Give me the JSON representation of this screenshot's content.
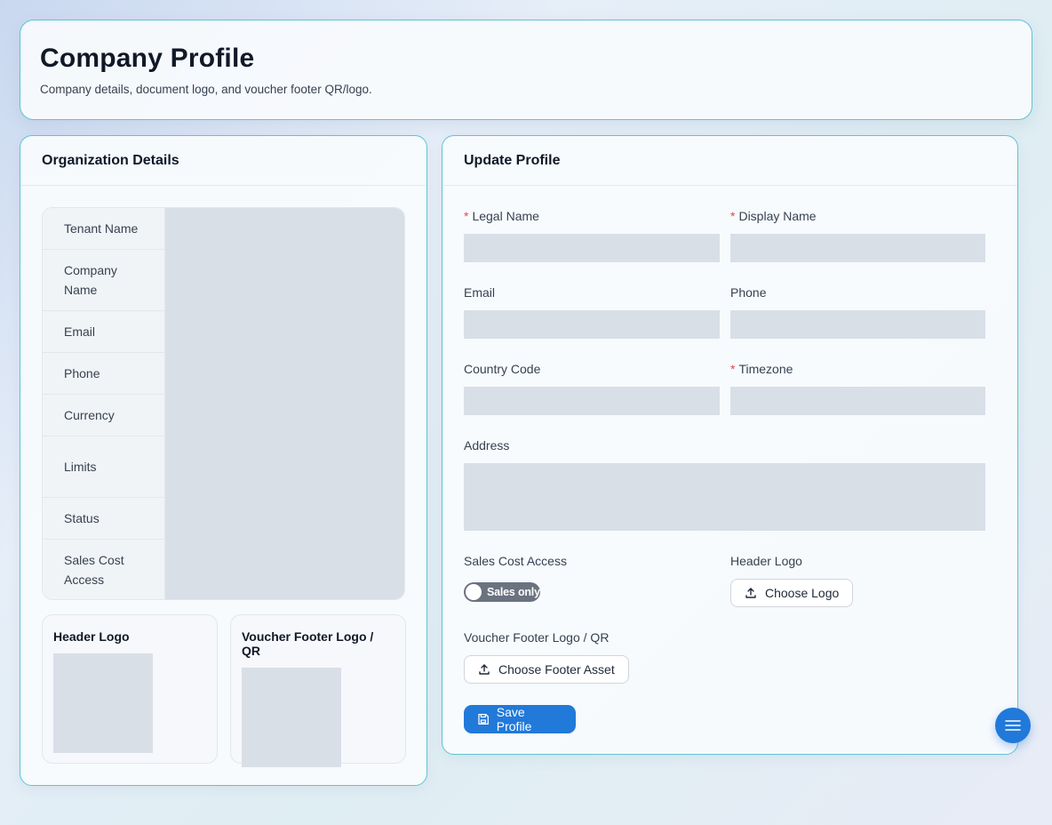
{
  "header": {
    "title": "Company Profile",
    "subtitle": "Company details, document logo, and voucher footer QR/logo."
  },
  "org_details": {
    "title": "Organization Details",
    "rows": [
      {
        "label": "Tenant Name"
      },
      {
        "label": "Company Name"
      },
      {
        "label": "Email"
      },
      {
        "label": "Phone"
      },
      {
        "label": "Currency"
      },
      {
        "label": "Limits"
      },
      {
        "label": "Status"
      },
      {
        "label": "Sales Cost Access"
      }
    ],
    "header_logo_title": "Header Logo",
    "footer_logo_title": "Voucher Footer Logo / QR"
  },
  "update_profile": {
    "title": "Update Profile",
    "required_mark": "*",
    "fields": {
      "legal_name": {
        "label": "Legal Name",
        "required": true,
        "value": ""
      },
      "display_name": {
        "label": "Display Name",
        "required": true,
        "value": ""
      },
      "email": {
        "label": "Email",
        "required": false,
        "value": ""
      },
      "phone": {
        "label": "Phone",
        "required": false,
        "value": ""
      },
      "country_code": {
        "label": "Country Code",
        "required": false,
        "value": ""
      },
      "timezone": {
        "label": "Timezone",
        "required": true,
        "value": ""
      },
      "address": {
        "label": "Address",
        "required": false,
        "value": ""
      }
    },
    "sales_cost_access": {
      "label": "Sales Cost Access",
      "toggle_text": "Sales only",
      "enabled": false
    },
    "header_logo": {
      "label": "Header Logo",
      "button": "Choose Logo"
    },
    "footer_logo": {
      "label": "Voucher Footer Logo / QR",
      "button": "Choose Footer Asset"
    },
    "save_button": "Save Profile"
  },
  "icons": {
    "upload": "upload-icon",
    "save": "save-icon",
    "menu": "menu-icon"
  },
  "colors": {
    "accent": "#2179d9",
    "card_border": "#5fc4d2",
    "placeholder": "#d9dfe7",
    "required": "#e5484d"
  }
}
